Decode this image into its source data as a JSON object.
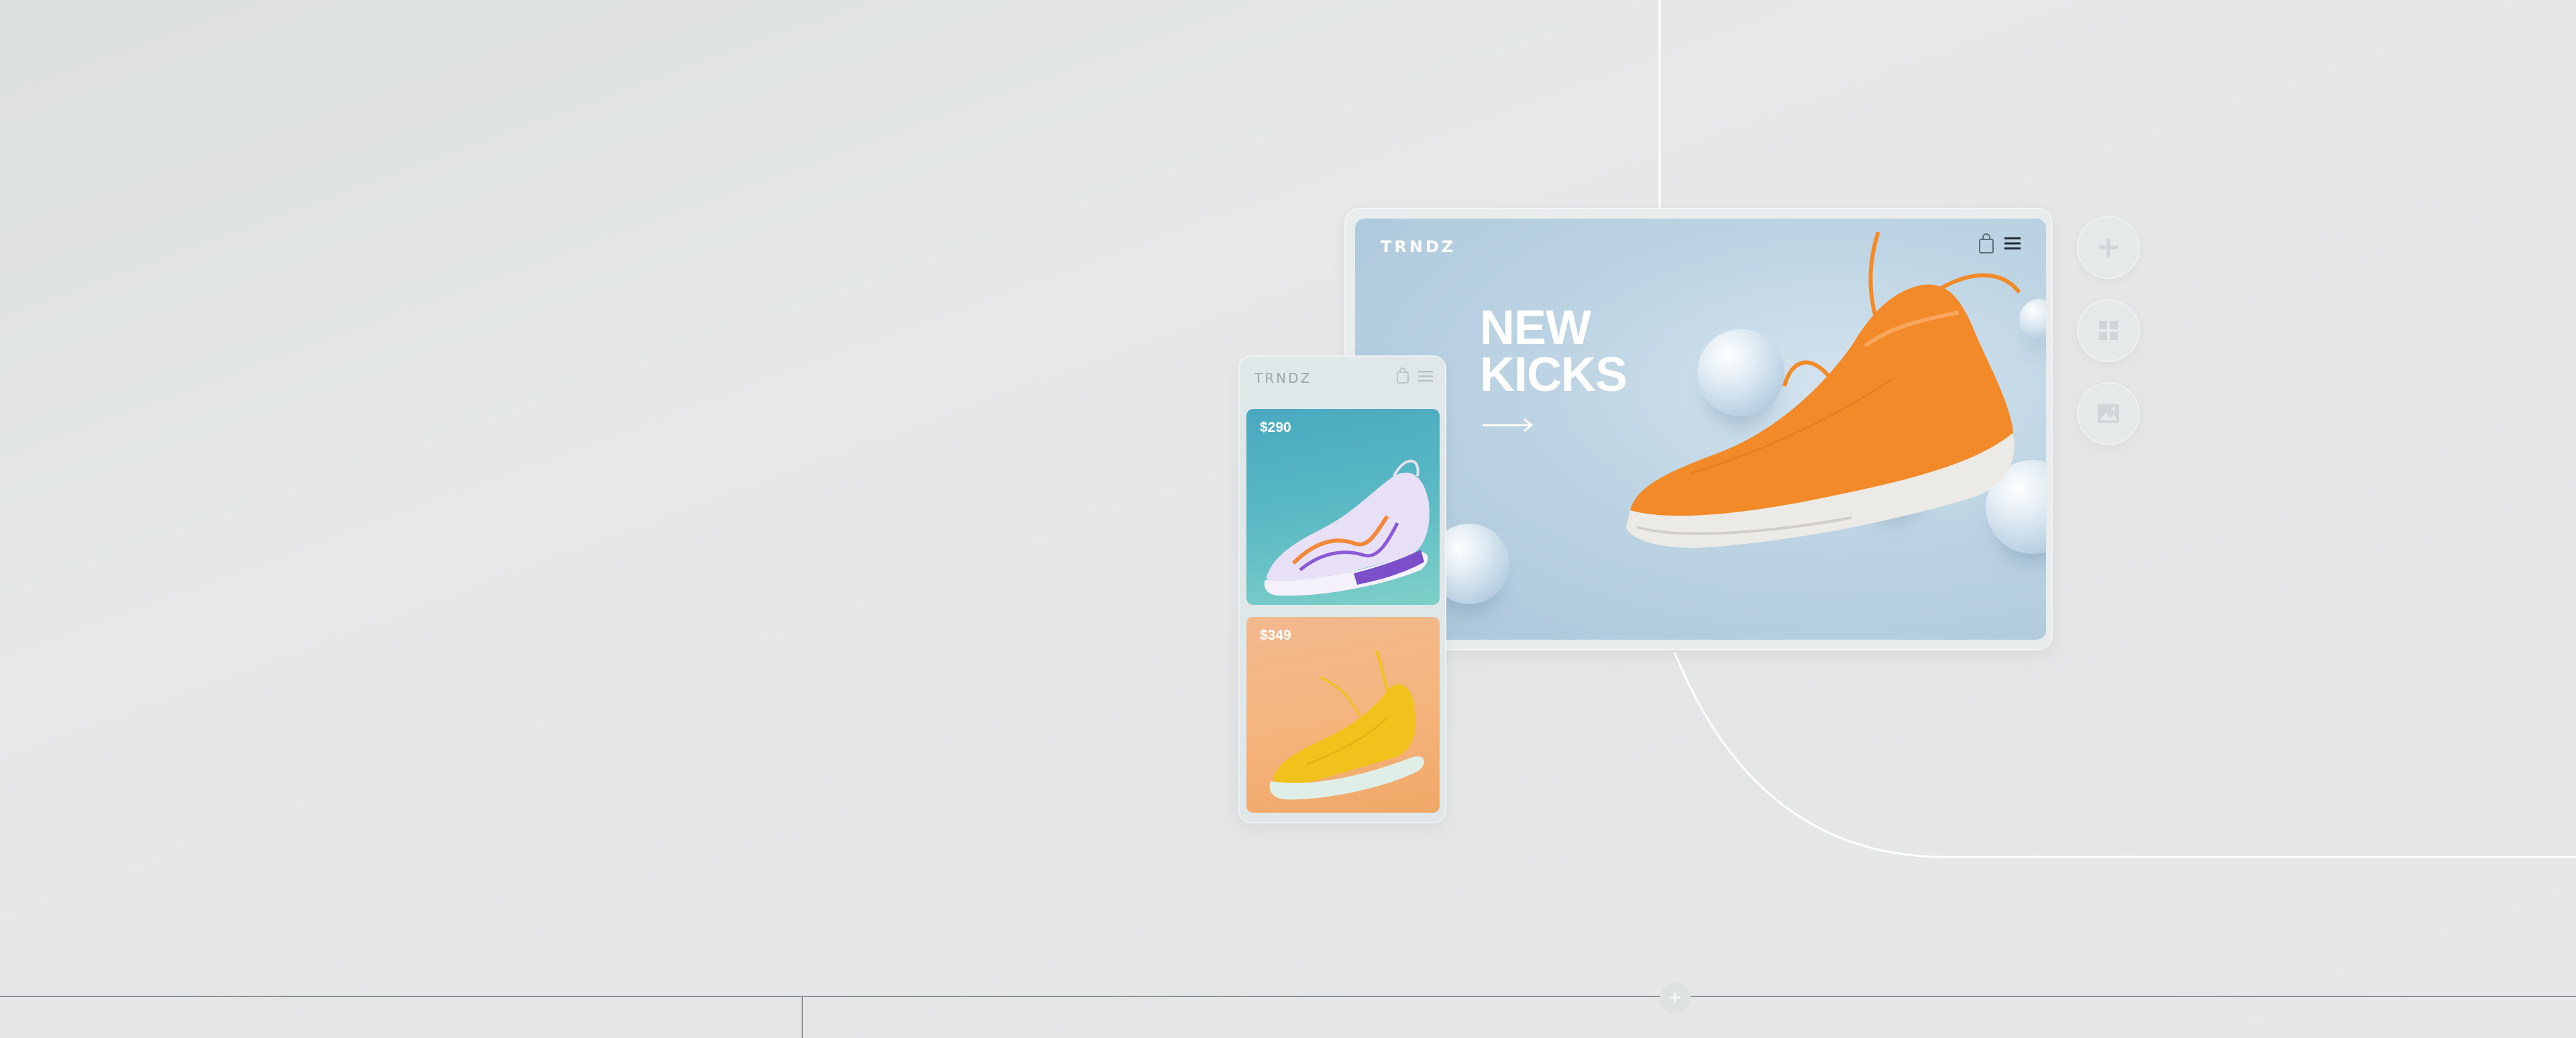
{
  "tablet": {
    "brand": "TRNDZ",
    "hero_title_line1": "NEW",
    "hero_title_line2": "KICKS",
    "arrow_icon": "arrow-right-icon",
    "bag_icon": "shopping-bag-icon",
    "menu_icon": "hamburger-menu-icon",
    "product_color": "#f28a2a"
  },
  "side_actions": [
    {
      "icon": "plus-icon"
    },
    {
      "icon": "grid-icon"
    },
    {
      "icon": "image-icon"
    }
  ],
  "phone": {
    "brand": "TRNDZ",
    "bag_icon": "shopping-bag-icon",
    "menu_icon": "hamburger-menu-icon",
    "products": [
      {
        "price": "$290",
        "color": "#b9a7e8"
      },
      {
        "price": "$349",
        "color": "#f2c21c"
      }
    ]
  },
  "bottom_action": {
    "icon": "plus-icon"
  },
  "colors": {
    "background": "#e3e5e6",
    "tablet_bg": "#bcd3e3",
    "card1_bg": "#5ab9c4",
    "card2_bg": "#f5b57e",
    "accent_orange": "#f28a2a"
  }
}
